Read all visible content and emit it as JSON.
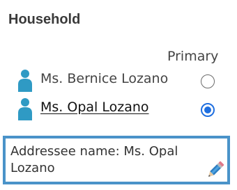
{
  "household": {
    "title": "Household",
    "primary_header": "Primary"
  },
  "members": [
    {
      "name": "Ms. Bernice Lozano",
      "primary": false,
      "icon": "person-icon"
    },
    {
      "name": "Ms. Opal Lozano",
      "primary": true,
      "icon": "person-icon"
    }
  ],
  "addressee": {
    "text": "Addressee name: Ms. Opal Lozano",
    "edit_icon": "pencil-icon"
  },
  "colors": {
    "person_icon": "#2f9ac4",
    "radio_selected": "#1f6fe0",
    "addressee_border": "#4a93c9"
  }
}
